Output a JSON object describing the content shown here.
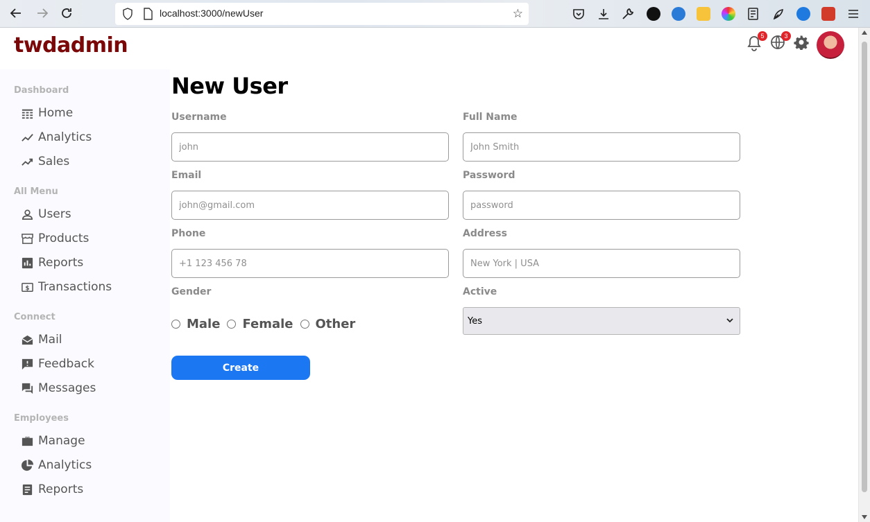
{
  "browser": {
    "url": "localhost:3000/newUser"
  },
  "app": {
    "logo": "twdadmin",
    "notifications_count": "5",
    "language_count": "3"
  },
  "sidebar": {
    "sections": [
      {
        "title": "Dashboard",
        "items": [
          {
            "label": "Home"
          },
          {
            "label": "Analytics"
          },
          {
            "label": "Sales"
          }
        ]
      },
      {
        "title": "All Menu",
        "items": [
          {
            "label": "Users"
          },
          {
            "label": "Products"
          },
          {
            "label": "Reports"
          },
          {
            "label": "Transactions"
          }
        ]
      },
      {
        "title": "Connect",
        "items": [
          {
            "label": "Mail"
          },
          {
            "label": "Feedback"
          },
          {
            "label": "Messages"
          }
        ]
      },
      {
        "title": "Employees",
        "items": [
          {
            "label": "Manage"
          },
          {
            "label": "Analytics"
          },
          {
            "label": "Reports"
          }
        ]
      }
    ]
  },
  "form": {
    "title": "New User",
    "username": {
      "label": "Username",
      "placeholder": "john"
    },
    "fullname": {
      "label": "Full Name",
      "placeholder": "John Smith"
    },
    "email": {
      "label": "Email",
      "placeholder": "john@gmail.com"
    },
    "password": {
      "label": "Password",
      "placeholder": "password"
    },
    "phone": {
      "label": "Phone",
      "placeholder": "+1 123 456 78"
    },
    "address": {
      "label": "Address",
      "placeholder": "New York | USA"
    },
    "gender": {
      "label": "Gender",
      "options": [
        "Male",
        "Female",
        "Other"
      ]
    },
    "active": {
      "label": "Active",
      "selected": "Yes"
    },
    "submit_label": "Create"
  },
  "colors": {
    "logo": "#7a0808",
    "primary_button": "#1b77f2",
    "badge": "#e0242a"
  }
}
